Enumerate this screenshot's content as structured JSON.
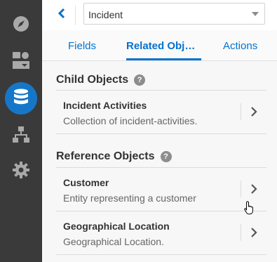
{
  "rail": {
    "items": [
      {
        "icon": "compass-icon",
        "active": false
      },
      {
        "icon": "layout-icon",
        "active": false
      },
      {
        "icon": "database-icon",
        "active": true
      },
      {
        "icon": "hierarchy-icon",
        "active": false
      },
      {
        "icon": "gear-icon",
        "active": false
      }
    ],
    "colors": {
      "background": "#3a3a3a",
      "icon": "#a9a9a9",
      "active": "#1677c8"
    }
  },
  "header": {
    "back_icon": "chevron-left-icon",
    "select": {
      "value": "Incident",
      "icon": "caret-down-icon"
    }
  },
  "tabs": [
    {
      "label": "Fields",
      "active": false
    },
    {
      "label": "Related Obj…",
      "active": true
    },
    {
      "label": "Actions",
      "active": false
    }
  ],
  "sections": {
    "child": {
      "title": "Child Objects",
      "help_icon": "?",
      "items": [
        {
          "title": "Incident Activities",
          "description": "Collection of incident-activities."
        }
      ]
    },
    "reference": {
      "title": "Reference Objects",
      "help_icon": "?",
      "items": [
        {
          "title": "Customer",
          "description": "Entity representing a customer"
        },
        {
          "title": "Geographical Location",
          "description": "Geographical Location."
        }
      ]
    }
  },
  "accent": "#0572ce"
}
